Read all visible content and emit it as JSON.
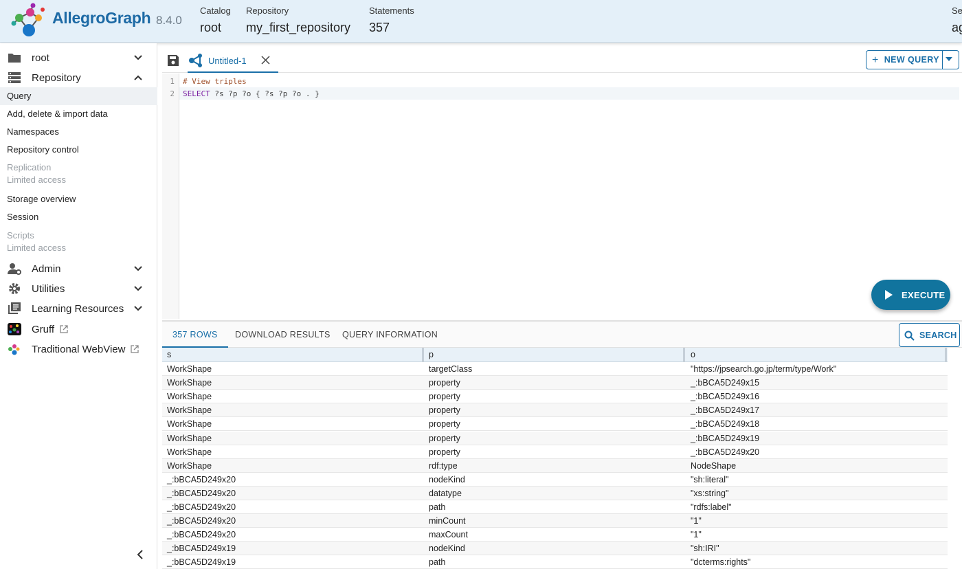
{
  "header": {
    "brand": "AllegroGraph",
    "version": "8.4.0",
    "catalog_label": "Catalog",
    "catalog_value": "root",
    "repository_label": "Repository",
    "repository_value": "my_first_repository",
    "statements_label": "Statements",
    "statements_value": "357",
    "session_label": "Se",
    "session_value": "ag"
  },
  "sidebar": {
    "catalog": "root",
    "repository": "Repository",
    "sub_items": [
      {
        "label": "Query"
      },
      {
        "label": "Add, delete & import data"
      },
      {
        "label": "Namespaces"
      },
      {
        "label": "Repository control"
      },
      {
        "label": "Replication",
        "note": "Limited access"
      },
      {
        "label": "Storage overview"
      },
      {
        "label": "Session"
      },
      {
        "label": "Scripts",
        "note": "Limited access"
      }
    ],
    "admin": "Admin",
    "utilities": "Utilities",
    "learning": "Learning Resources",
    "gruff": "Gruff",
    "webview": "Traditional WebView"
  },
  "editor": {
    "tab_name": "Untitled-1",
    "new_query": "NEW QUERY",
    "line_numbers": [
      "1",
      "2"
    ],
    "line1": "# View triples",
    "line2_kw": "SELECT",
    "line2_rest": " ?s ?p ?o { ?s ?p ?o . }",
    "execute": "EXECUTE"
  },
  "results": {
    "tabs": [
      "357 ROWS",
      "DOWNLOAD RESULTS",
      "QUERY INFORMATION"
    ],
    "search": "SEARCH",
    "columns": [
      "s",
      "p",
      "o"
    ],
    "rows": [
      [
        "WorkShape",
        "targetClass",
        "\"https://jpsearch.go.jp/term/type/Work\""
      ],
      [
        "WorkShape",
        "property",
        "_:bBCA5D249x15"
      ],
      [
        "WorkShape",
        "property",
        "_:bBCA5D249x16"
      ],
      [
        "WorkShape",
        "property",
        "_:bBCA5D249x17"
      ],
      [
        "WorkShape",
        "property",
        "_:bBCA5D249x18"
      ],
      [
        "WorkShape",
        "property",
        "_:bBCA5D249x19"
      ],
      [
        "WorkShape",
        "property",
        "_:bBCA5D249x20"
      ],
      [
        "WorkShape",
        "rdf:type",
        "NodeShape"
      ],
      [
        "_:bBCA5D249x20",
        "nodeKind",
        "\"sh:literal\""
      ],
      [
        "_:bBCA5D249x20",
        "datatype",
        "\"xs:string\""
      ],
      [
        "_:bBCA5D249x20",
        "path",
        "\"rdfs:label\""
      ],
      [
        "_:bBCA5D249x20",
        "minCount",
        "\"1\""
      ],
      [
        "_:bBCA5D249x20",
        "maxCount",
        "\"1\""
      ],
      [
        "_:bBCA5D249x19",
        "nodeKind",
        "\"sh:IRI\""
      ],
      [
        "_:bBCA5D249x19",
        "path",
        "\"dcterms:rights\""
      ]
    ]
  },
  "colors": {
    "accent": "#1a6fa8",
    "header_bg": "#e4f0f9",
    "execute_bg": "#11749e"
  }
}
